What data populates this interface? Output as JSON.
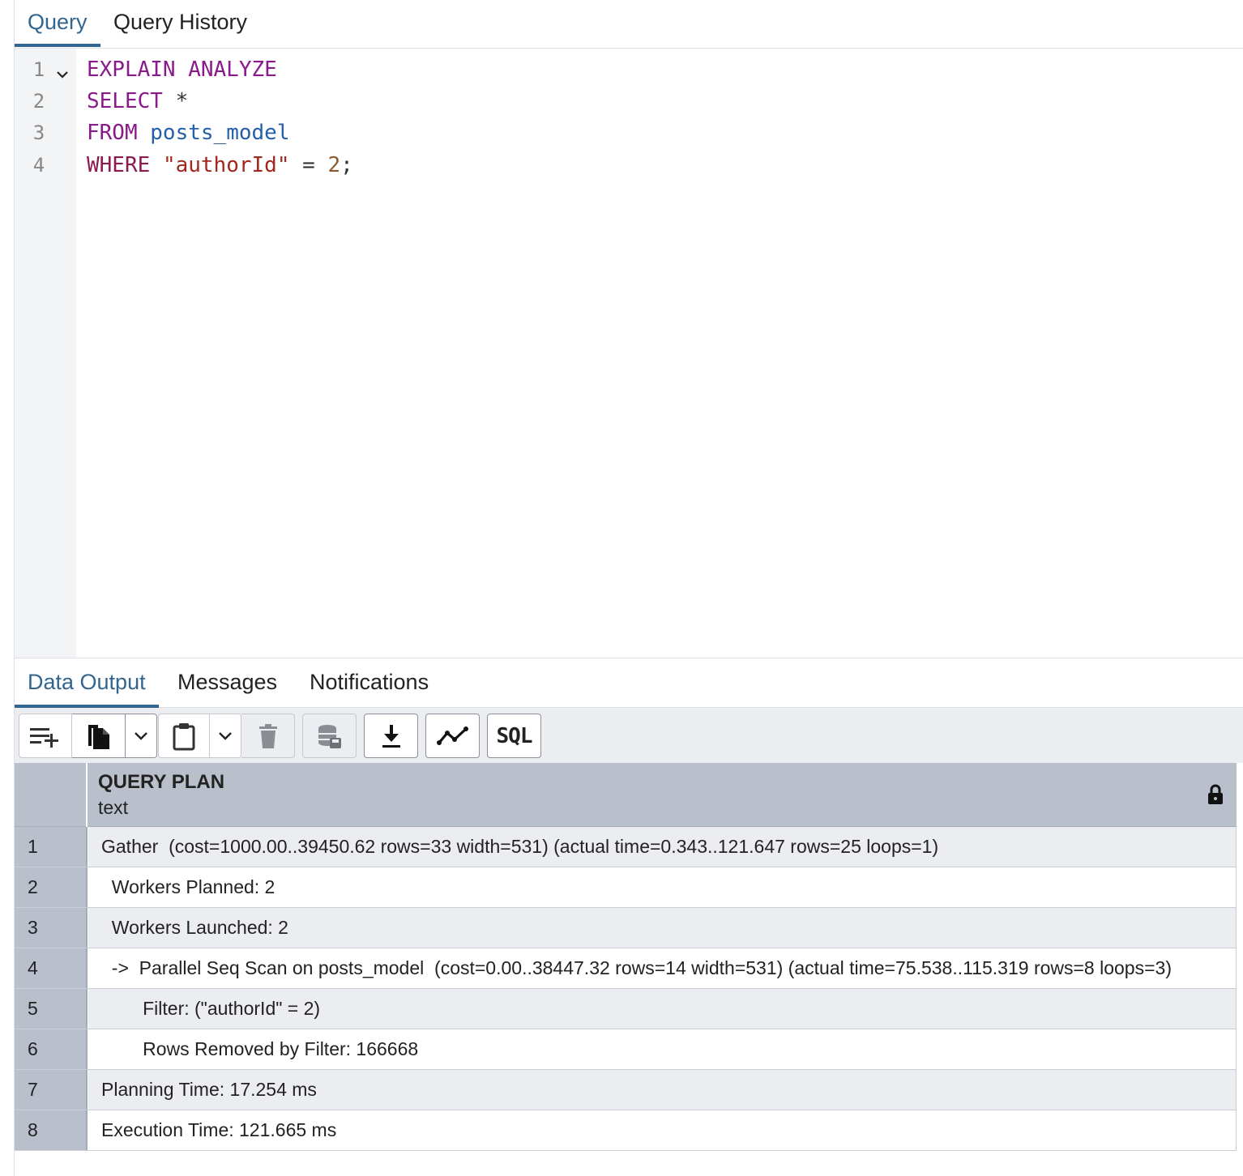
{
  "top_tabs": [
    {
      "label": "Query",
      "active": true
    },
    {
      "label": "Query History",
      "active": false
    }
  ],
  "editor": {
    "line_numbers": [
      "1",
      "2",
      "3",
      "4"
    ],
    "lines": [
      [
        {
          "t": "EXPLAIN ANALYZE",
          "c": "kw"
        }
      ],
      [
        {
          "t": "SELECT",
          "c": "kw"
        },
        {
          "t": " *",
          "c": "op"
        }
      ],
      [
        {
          "t": "FROM",
          "c": "kw"
        },
        {
          "t": " ",
          "c": "op"
        },
        {
          "t": "posts_model",
          "c": "id"
        }
      ],
      [
        {
          "t": "WHERE",
          "c": "kw2"
        },
        {
          "t": " ",
          "c": "op"
        },
        {
          "t": "\"authorId\"",
          "c": "str"
        },
        {
          "t": " = ",
          "c": "op"
        },
        {
          "t": "2",
          "c": "num"
        },
        {
          "t": ";",
          "c": "op"
        }
      ]
    ]
  },
  "output_tabs": [
    {
      "label": "Data Output",
      "active": true
    },
    {
      "label": "Messages",
      "active": false
    },
    {
      "label": "Notifications",
      "active": false
    }
  ],
  "toolbar": {
    "sql_label": "SQL"
  },
  "grid": {
    "column": {
      "name": "QUERY PLAN",
      "type": "text"
    },
    "rows": [
      {
        "num": "1",
        "text": "Gather  (cost=1000.00..39450.62 rows=33 width=531) (actual time=0.343..121.647 rows=25 loops=1)"
      },
      {
        "num": "2",
        "text": "  Workers Planned: 2"
      },
      {
        "num": "3",
        "text": "  Workers Launched: 2"
      },
      {
        "num": "4",
        "text": "  ->  Parallel Seq Scan on posts_model  (cost=0.00..38447.32 rows=14 width=531) (actual time=75.538..115.319 rows=8 loops=3)"
      },
      {
        "num": "5",
        "text": "        Filter: (\"authorId\" = 2)"
      },
      {
        "num": "6",
        "text": "        Rows Removed by Filter: 166668"
      },
      {
        "num": "7",
        "text": "Planning Time: 17.254 ms"
      },
      {
        "num": "8",
        "text": "Execution Time: 121.665 ms"
      }
    ]
  },
  "colors": {
    "accent": "#326690",
    "grid_header": "#b9bfcb",
    "toolbar_bg": "#ebedf0"
  }
}
